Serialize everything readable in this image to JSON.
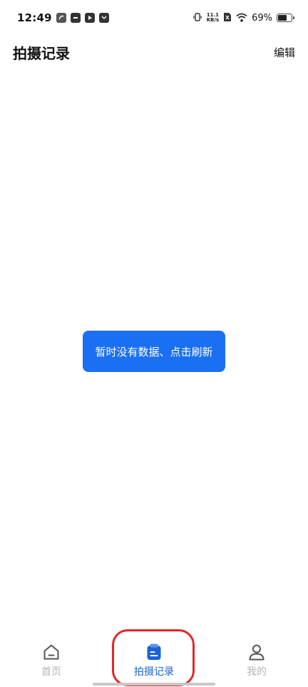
{
  "status_bar": {
    "time": "12:49",
    "net_speed_value": "11.1",
    "net_speed_unit": "KB/s",
    "battery_percent": "69%",
    "battery_level": 0.69
  },
  "header": {
    "title": "拍摄记录",
    "edit_label": "编辑"
  },
  "empty_state": {
    "label": "暂时没有数据、点击刷新"
  },
  "bottom_nav": {
    "items": [
      {
        "label": "首页",
        "icon": "home-icon",
        "active": false
      },
      {
        "label": "拍摄记录",
        "icon": "clipboard-icon",
        "active": true
      },
      {
        "label": "我的",
        "icon": "person-icon",
        "active": false
      }
    ]
  },
  "colors": {
    "accent": "#1a6ff2",
    "active_nav": "#1a62d6",
    "inactive_nav": "#b5b5b5",
    "highlight": "#e02828"
  }
}
